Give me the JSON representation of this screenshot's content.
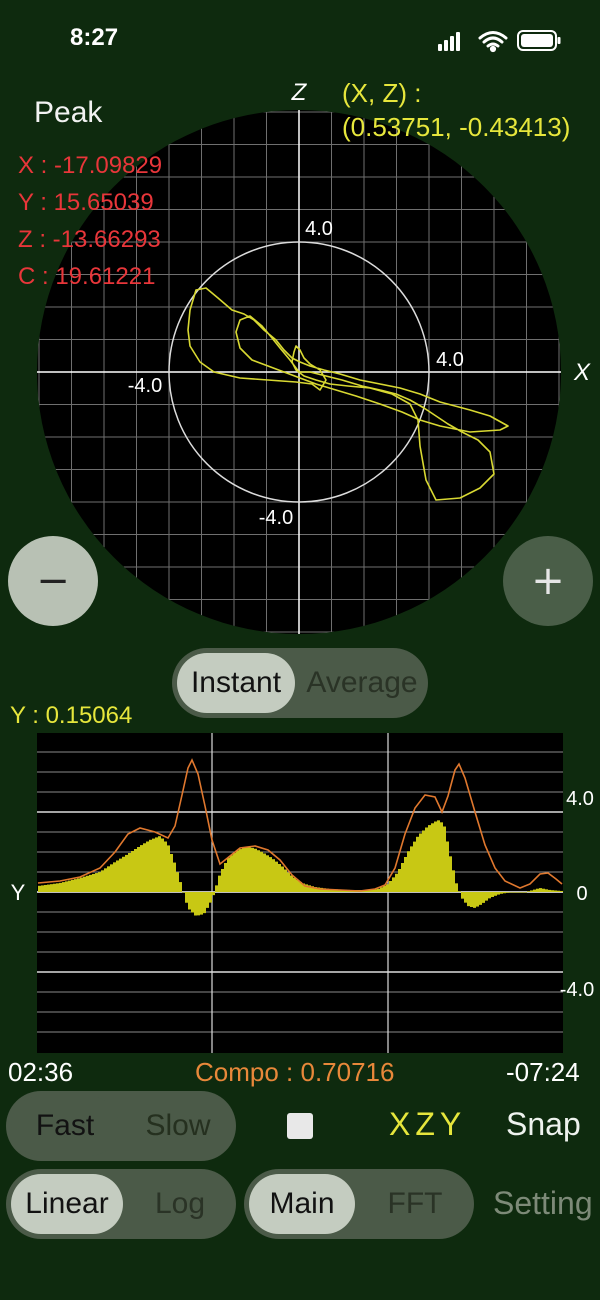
{
  "status_bar": {
    "time": "8:27"
  },
  "scope": {
    "vertical_axis": "Z",
    "horizontal_axis": "X",
    "tick_positive_y": "4.0",
    "tick_positive_x": "4.0",
    "tick_negative_x": "-4.0",
    "tick_negative_y": "-4.0",
    "coord_title": "(X, Z)  :",
    "coord_value": "(0.53751, -0.43413)"
  },
  "peak": {
    "title": "Peak",
    "x": "X : -17.09829",
    "y": "Y : 15.65039",
    "z": "Z : -13.66293",
    "c": "C : 19.61221"
  },
  "zoom": {
    "out_label": "−",
    "in_label": "+"
  },
  "mode_toggle": {
    "options": [
      "Instant",
      "Average"
    ],
    "selected": "Instant"
  },
  "waveform": {
    "value_label": "Y : 0.15064",
    "axis_label": "Y",
    "tick_top": "4.0",
    "tick_zero": "0",
    "tick_bottom": "-4.0",
    "time_start": "02:36",
    "compo_label": "Compo : 0.70716",
    "time_end": "-07:24"
  },
  "speed_toggle": {
    "options": [
      "Fast",
      "Slow"
    ],
    "selected": "Fast"
  },
  "scale_toggle": {
    "options": [
      "Linear",
      "Log"
    ],
    "selected": "Linear"
  },
  "view_toggle": {
    "options": [
      "Main",
      "FFT"
    ],
    "selected": "Main"
  },
  "controls": {
    "axis_order": "XZY",
    "snap": "Snap",
    "setting": "Setting"
  },
  "colors": {
    "background": "#0e2a0e",
    "scope": "#000000",
    "trace": "#e6e63c",
    "peak_text": "#e8363a",
    "compo": "#e8883a"
  }
}
